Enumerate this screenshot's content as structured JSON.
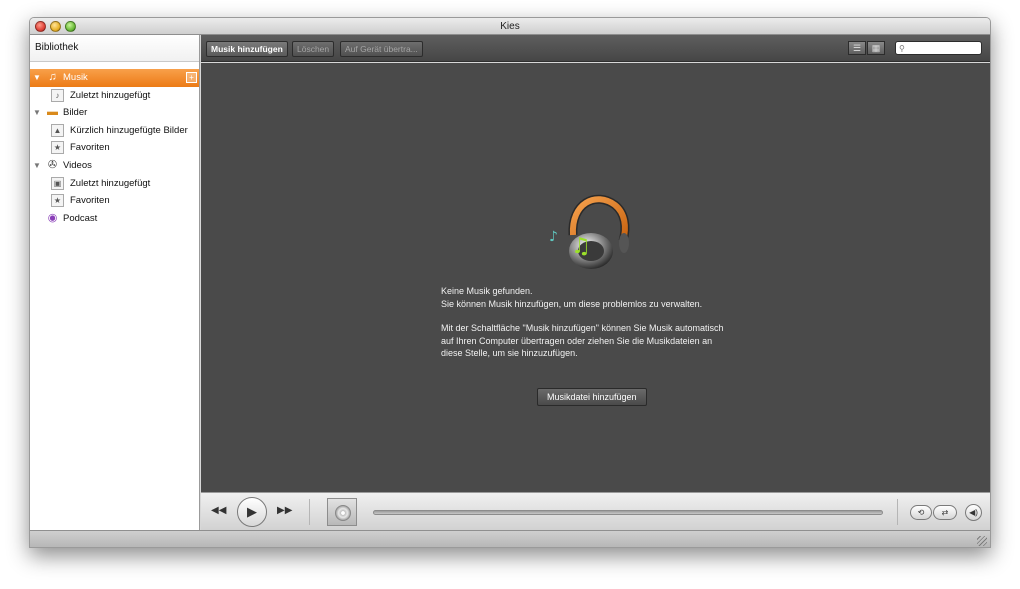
{
  "window": {
    "title": "Kies"
  },
  "sidebar": {
    "header": "Bibliothek",
    "items": [
      {
        "label": "Musik",
        "icon": "music-note-icon"
      },
      {
        "label": "Zuletzt hinzugefügt",
        "icon": "music-playlist-icon"
      },
      {
        "label": "Bilder",
        "icon": "folder-icon"
      },
      {
        "label": "Kürzlich hinzugefügte Bilder",
        "icon": "image-playlist-icon"
      },
      {
        "label": "Favoriten",
        "icon": "star-icon"
      },
      {
        "label": "Videos",
        "icon": "film-reel-icon"
      },
      {
        "label": "Zuletzt hinzugefügt",
        "icon": "video-playlist-icon"
      },
      {
        "label": "Favoriten",
        "icon": "star-icon"
      },
      {
        "label": "Podcast",
        "icon": "podcast-icon"
      }
    ]
  },
  "toolbar": {
    "add_music": "Musik hinzufügen",
    "delete": "Löschen",
    "transfer": "Auf Gerät übertra...",
    "search_placeholder": ""
  },
  "main": {
    "line1": "Keine Musik gefunden.",
    "line2": "Sie können Musik hinzufügen, um diese problemlos zu verwalten.",
    "line3": "Mit der Schaltfläche \"Musik hinzufügen\" können Sie Musik automatisch",
    "line4": "auf Ihren Computer übertragen oder ziehen Sie die Musikdateien an",
    "line5": "diese Stelle, um sie hinzuzufügen.",
    "add_file_button": "Musikdatei hinzufügen"
  },
  "colors": {
    "accent": "#ec7b16",
    "main_bg": "#4a4a4a"
  }
}
